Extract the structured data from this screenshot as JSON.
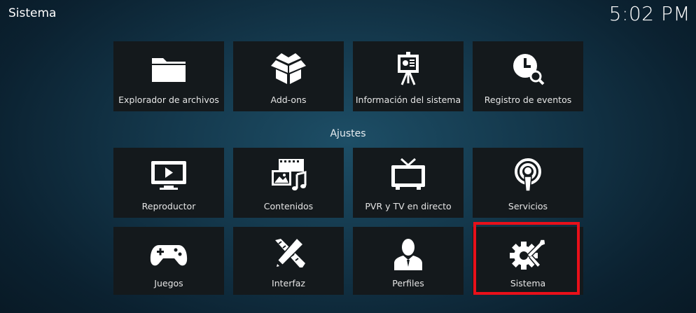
{
  "header": {
    "title": "Sistema",
    "clock": "5:02 PM"
  },
  "top_row": [
    {
      "label": "Explorador de archivos",
      "icon": "folder-icon"
    },
    {
      "label": "Add-ons",
      "icon": "box-icon"
    },
    {
      "label": "Información del sistema",
      "icon": "presentation-board-icon"
    },
    {
      "label": "Registro de eventos",
      "icon": "clock-search-icon"
    }
  ],
  "section": {
    "label": "Ajustes"
  },
  "settings": [
    {
      "label": "Reproductor",
      "icon": "monitor-play-icon"
    },
    {
      "label": "Contenidos",
      "icon": "media-library-icon"
    },
    {
      "label": "PVR y TV en directo",
      "icon": "tv-icon"
    },
    {
      "label": "Servicios",
      "icon": "podcast-icon"
    },
    {
      "label": "Juegos",
      "icon": "gamepad-icon"
    },
    {
      "label": "Interfaz",
      "icon": "ruler-pencil-icon"
    },
    {
      "label": "Perfiles",
      "icon": "user-profile-icon"
    },
    {
      "label": "Sistema",
      "icon": "gear-tools-icon"
    }
  ],
  "focused_item": "Sistema",
  "colors": {
    "focus": "#e8101a",
    "tile": "#14191c",
    "background": "#14384c"
  }
}
